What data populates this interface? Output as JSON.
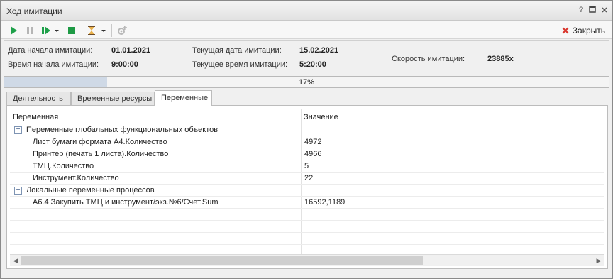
{
  "window": {
    "title": "Ход имитации",
    "controls": [
      "?",
      "▢",
      "✕"
    ]
  },
  "toolbar": {
    "close_label": "Закрыть",
    "icons": [
      "play-icon",
      "pause-icon",
      "step-icon",
      "dropdown-arrow-icon",
      "stop-icon",
      "hourglass-icon",
      "dropdown-arrow-icon",
      "gear-add-icon"
    ]
  },
  "info": {
    "start_date_label": "Дата начала имитации:",
    "start_date": "01.01.2021",
    "start_time_label": "Время начала имитации:",
    "start_time": "9:00:00",
    "current_date_label": "Текущая дата имитации:",
    "current_date": "15.02.2021",
    "current_time_label": "Текущее время имитации:",
    "current_time": "5:20:00",
    "speed_label": "Скорость имитации:",
    "speed": "23885x"
  },
  "progress": {
    "text": "17%",
    "value": 0.17
  },
  "tabs": [
    {
      "label": "Деятельность",
      "active": false
    },
    {
      "label": "Временные ресурсы",
      "active": false
    },
    {
      "label": "Переменные",
      "active": true
    }
  ],
  "grid": {
    "columns": [
      "Переменная",
      "Значение"
    ],
    "groups": [
      {
        "name": "Переменные глобальных функциональных объектов",
        "rows": [
          {
            "name": "Лист бумаги формата А4.Количество",
            "value": "4972"
          },
          {
            "name": "Принтер (печать 1 листа).Количество",
            "value": "4966"
          },
          {
            "name": "ТМЦ.Количество",
            "value": "5"
          },
          {
            "name": "Инструмент.Количество",
            "value": "22"
          }
        ]
      },
      {
        "name": "Локальные переменные процессов",
        "rows": [
          {
            "name": "А6.4 Закупить ТМЦ и инструмент/экз.№6/Счет.Sum",
            "value": "16592,1189"
          }
        ]
      }
    ]
  },
  "colors": {
    "play": "#1ea04a",
    "stop": "#1e9a45",
    "close_x": "#d9342b",
    "progress_fill": "#cfd9e6"
  }
}
